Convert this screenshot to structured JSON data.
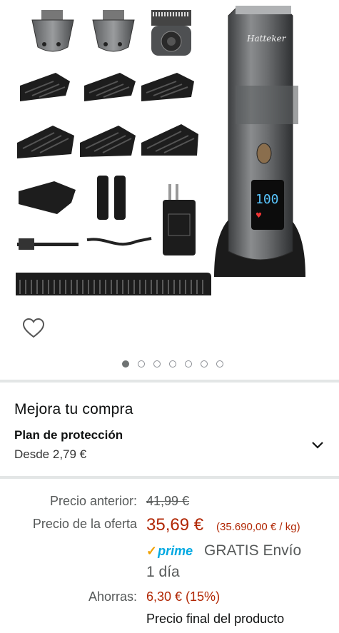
{
  "product": {
    "brand_logo": "Hatteker",
    "display_reading": "100",
    "image_count": 7,
    "active_image": 1
  },
  "icons": {
    "wishlist": "heart-outline-icon",
    "expand": "chevron-down-icon",
    "prime_check": "checkmark-icon"
  },
  "upgrade": {
    "title": "Mejora tu compra",
    "plan_name": "Plan de protección",
    "plan_price": "Desde 2,79 €"
  },
  "pricing": {
    "previous_label": "Precio anterior:",
    "previous_value": "41,99 €",
    "offer_label": "Precio de la oferta",
    "offer_value": "35,69 €",
    "unit_price": "(35.690,00 € / kg)",
    "prime_check": "✓",
    "prime_label": "prime",
    "shipping": "GRATIS Envío",
    "shipping_time": "1 día",
    "savings_label": "Ahorras:",
    "savings_value": "6,30 € (15%)",
    "final_note": "Precio final del producto"
  },
  "colors": {
    "price_red": "#b12704",
    "prime_blue": "#00a8e1",
    "prime_check": "#f0a100",
    "divider": "#e3e6e6"
  }
}
